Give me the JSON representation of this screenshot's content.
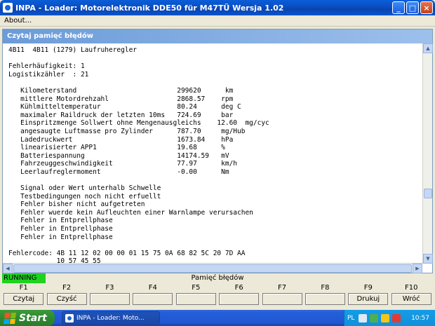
{
  "window": {
    "title": "INPA - Loader:  Motorelektronik DDE50 für M47TÜ Wersja 1.02",
    "buttons": {
      "minimize": "_",
      "maximize": "□",
      "close": "×"
    }
  },
  "menu": {
    "about": "About..."
  },
  "panel": {
    "header": "Czytaj pamięć błędów",
    "text": "4B11  4B11 (1279) Laufruheregler\n\nFehlerhäufigkeit: 1\nLogistikzähler  : 21\n\n   Kilometerstand                         299620      km\n   mittlere Motordrehzahl                 2868.57    rpm\n   Kühlmitteltemperatur                   80.24      deg C\n   maximaler Raildruck der letzten 10ms   724.69     bar\n   Einspritzmenge Sollwert ohne Mengenausgleichs    12.60  mg/cyc\n   angesaugte Luftmasse pro Zylinder      787.70     mg/Hub\n   Ladedruckwert                          1673.84    hPa\n   linearisierter APP1                    19.68      %\n   Batteriespannung                       14174.59   mV\n   Fahrzeuggeschwindigkeit                77.97      km/h\n   Leerlaufreglermoment                   -0.00      Nm\n\n   Signal oder Wert unterhalb Schwelle\n   Testbedingungen noch nicht erfuellt\n   Fehler bisher nicht aufgetreten\n   Fehler wuerde kein Aufleuchten einer Warnlampe verursachen\n   Fehler in Entprellphase\n   Fehler in Entprellphase\n   Fehler in Entprellphase\n\nFehlercode: 4B 11 12 02 00 00 01 15 75 0A 68 82 5C 20 7D AA\n            10 57 45 55"
  },
  "status": {
    "running": "RUNNING",
    "title": "Pamięć błędów"
  },
  "fkeys": [
    {
      "num": "F1",
      "label": "Czytaj"
    },
    {
      "num": "F2",
      "label": "Czyść"
    },
    {
      "num": "F3",
      "label": ""
    },
    {
      "num": "F4",
      "label": ""
    },
    {
      "num": "F5",
      "label": ""
    },
    {
      "num": "F6",
      "label": ""
    },
    {
      "num": "F7",
      "label": ""
    },
    {
      "num": "F8",
      "label": ""
    },
    {
      "num": "F9",
      "label": "Drukuj"
    },
    {
      "num": "F10",
      "label": "Wróć"
    }
  ],
  "taskbar": {
    "start": "Start",
    "task": "INPA - Loader: Moto...",
    "lang": "PL",
    "clock": "10:57"
  },
  "colors": {
    "running_bg": "#1fd21f",
    "panel_header": "#7ba6e0",
    "taskbar": "#245edb"
  }
}
